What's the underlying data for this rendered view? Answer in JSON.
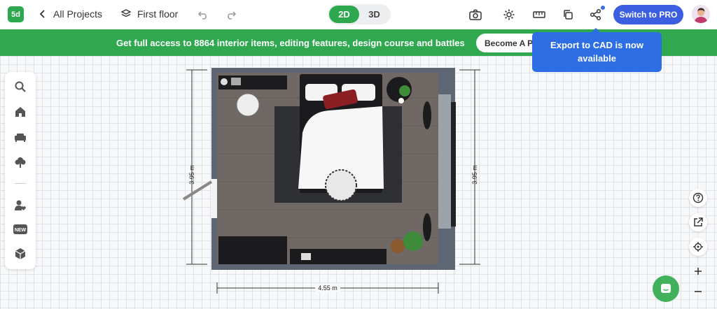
{
  "topbar": {
    "logo_text": "5d",
    "back_label": "All Projects",
    "floor_label": "First floor",
    "view_modes": [
      "2D",
      "3D"
    ],
    "active_view": "2D",
    "pro_button_label": "Switch to PRO"
  },
  "banner": {
    "text": "Get full access to 8864 interior items, editing features, design course and battles",
    "button_label": "Become A Pro"
  },
  "tooltip": {
    "text": "Export to CAD is now available"
  },
  "dimensions": {
    "left_height": "3.95 m",
    "right_height": "3.95 m",
    "bottom_width": "4.55 m"
  },
  "colors": {
    "brand_green": "#2ea84f",
    "pro_blue": "#3b5fe0",
    "tooltip_blue": "#2d6ee5",
    "floor_wood": "#706a66",
    "wall": "#5d6672"
  },
  "icons": {
    "sidebar": [
      "search-icon",
      "home-icon",
      "sofa-icon",
      "tree-icon",
      "user-heart-icon",
      "new-badge-icon",
      "box-icon"
    ],
    "right": [
      "help-icon",
      "external-link-icon",
      "locate-icon",
      "plus-icon",
      "minus-icon"
    ]
  }
}
